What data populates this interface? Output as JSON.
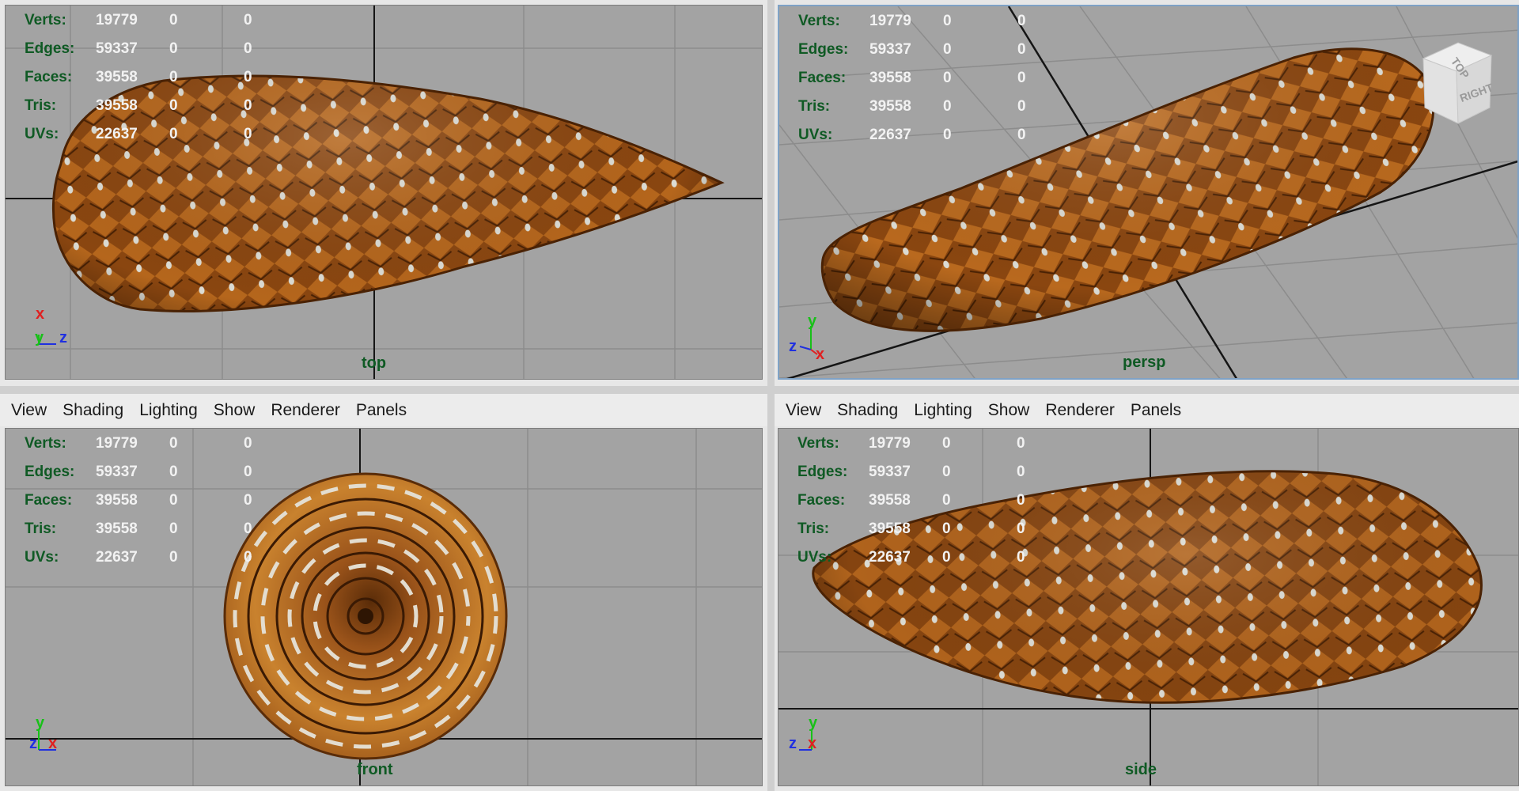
{
  "menu": [
    "View",
    "Shading",
    "Lighting",
    "Show",
    "Renderer",
    "Panels"
  ],
  "hud": {
    "labels": [
      "Verts:",
      "Edges:",
      "Faces:",
      "Tris:",
      "UVs:"
    ],
    "counts": [
      "19779",
      "59337",
      "39558",
      "39558",
      "22637"
    ],
    "zero": "0"
  },
  "viewports": {
    "top": {
      "camera": "top",
      "axes": [
        "x",
        "y",
        "z"
      ]
    },
    "persp": {
      "camera": "persp",
      "axes": [
        "y",
        "z",
        "x"
      ]
    },
    "front": {
      "camera": "front",
      "axes": [
        "y",
        "z",
        "x"
      ]
    },
    "side": {
      "camera": "side",
      "axes": [
        "y",
        "z",
        "x"
      ]
    }
  },
  "view_cube": {
    "top_face": "TOP",
    "right_face": "RIGHT"
  },
  "colors": {
    "viewport_bg": "#a3a3a3",
    "grid": "#8c8c8c",
    "hud_label": "#0f5a24",
    "hud_value": "#f2f2f2",
    "active_border": "#7fa2c6",
    "axis_x": "#e02020",
    "axis_y": "#18c018",
    "axis_z": "#2030e0",
    "cone_base": "#b5661c",
    "cone_dark": "#6b3408",
    "cone_tip": "#dcdcd4"
  }
}
